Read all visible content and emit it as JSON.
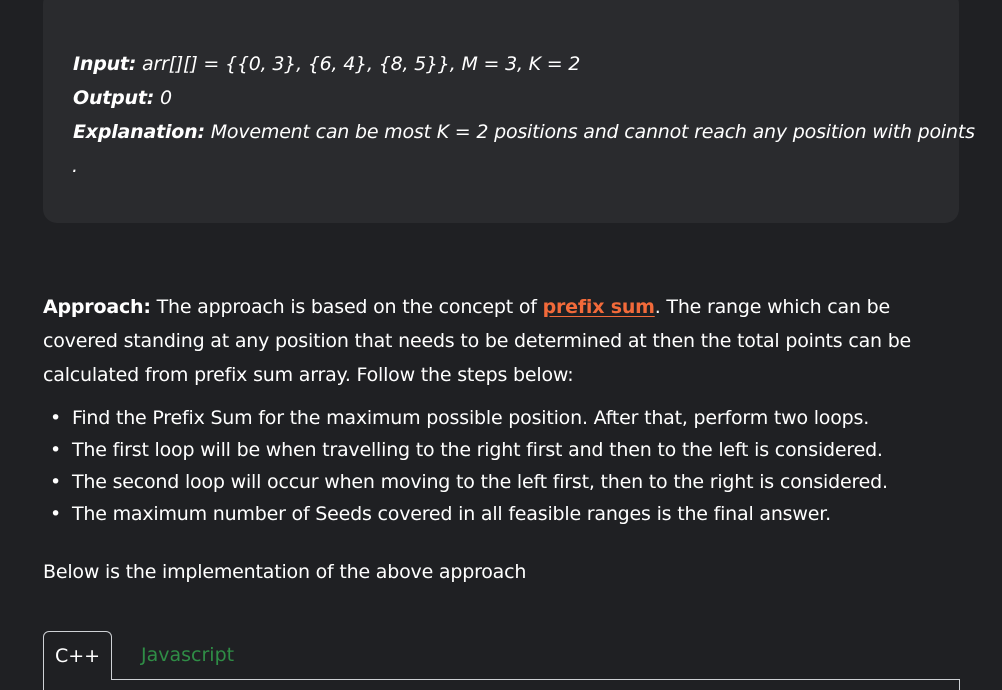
{
  "example": {
    "input_label": "Input:",
    "input_value": " arr[][] = {{0, 3}, {6, 4}, {8, 5}}, M = 3, K = 2",
    "output_label": "Output:",
    "output_value": " 0",
    "explanation_label": "Explanation:",
    "explanation_value": " Movement can be most K = 2 positions and cannot reach any position with points",
    "trailing_dot": "."
  },
  "approach": {
    "label": "Approach:",
    "text_before_link": " The approach is based on the concept of ",
    "link_text": "prefix sum",
    "text_after_link": ". The range which can be covered standing at any position that needs to be determined at then the total points can be calculated from prefix sum array. Follow the steps below:"
  },
  "steps": [
    "Find the Prefix Sum for the maximum possible position. After that, perform two loops.",
    "The first loop will be when travelling to the right first and then to the left is considered.",
    "The second loop will occur when moving to the left first, then to the right is considered.",
    "The maximum number of Seeds covered in all feasible ranges is the final answer."
  ],
  "implementation_text": "Below is the implementation of the above approach",
  "tabs": {
    "cpp": "C++",
    "javascript": "Javascript"
  },
  "colors": {
    "background": "#1f2023",
    "example_box": "#2a2b2e",
    "link": "#f26a3a",
    "tab_active_text": "#ffffff",
    "tab_inactive_text": "#2f8d46"
  }
}
